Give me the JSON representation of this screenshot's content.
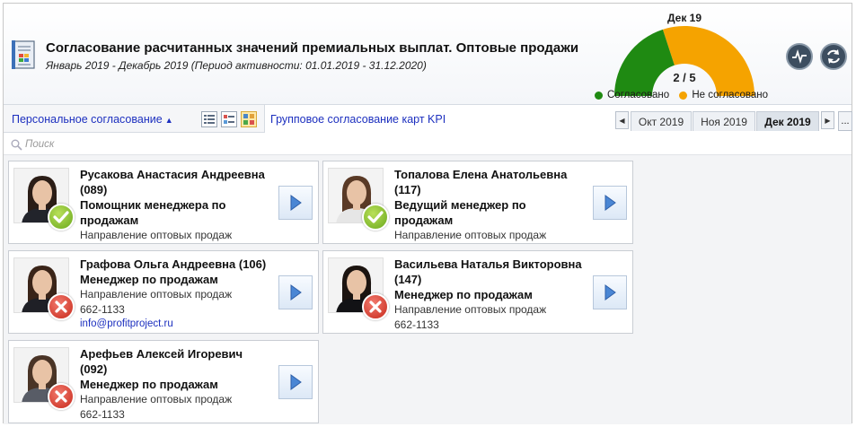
{
  "header": {
    "title": "Согласование расчитанных значений премиальных выплат. Оптовые продажи",
    "subtitle": "Январь 2019  - Декабрь 2019 (Период активности: 01.01.2019 - 31.12.2020)",
    "app_icon": "calendar-sheet-icon"
  },
  "gauge": {
    "date": "Дек 19",
    "count": "2 / 5",
    "approved": 2,
    "total": 5,
    "legend_approved": "Согласовано",
    "legend_not_approved": "Не согласовано",
    "color_approved": "#1f8a12",
    "color_not_approved": "#f5a300"
  },
  "buttons": {
    "activity_icon": "pulse-icon",
    "refresh_icon": "refresh-icon"
  },
  "toolbar": {
    "personal_label": "Персональное согласование",
    "group_label": "Групповое согласование карт KPI",
    "months": [
      "Окт 2019",
      "Ноя 2019",
      "Дек 2019"
    ],
    "active_month": "Дек 2019",
    "more_label": "..."
  },
  "search": {
    "placeholder": "Поиск"
  },
  "employees": [
    {
      "name": "Русакова Анастасия Андреевна (089)",
      "role": "Помощник менеджера по продажам",
      "dept": "Направление оптовых продаж",
      "status": "approved"
    },
    {
      "name": "Топалова Елена Анатольевна (117)",
      "role": "Ведущий менеджер по продажам",
      "dept": "Направление оптовых продаж",
      "status": "approved"
    },
    {
      "name": "Графова Ольга Андреевна  (106)",
      "role": "Менеджер по продажам",
      "dept": "Направление оптовых продаж",
      "phone": "662-1133",
      "email": "info@profitproject.ru",
      "status": "not_approved"
    },
    {
      "name": "Васильева Наталья Викторовна (147)",
      "role": "Менеджер по продажам",
      "dept": "Направление оптовых продаж",
      "phone": "662-1133",
      "status": "not_approved"
    },
    {
      "name": "Арефьев Алексей Игоревич (092)",
      "role": "Менеджер по продажам",
      "dept": "Направление оптовых продаж",
      "phone": "662-1133",
      "status": "not_approved"
    }
  ]
}
